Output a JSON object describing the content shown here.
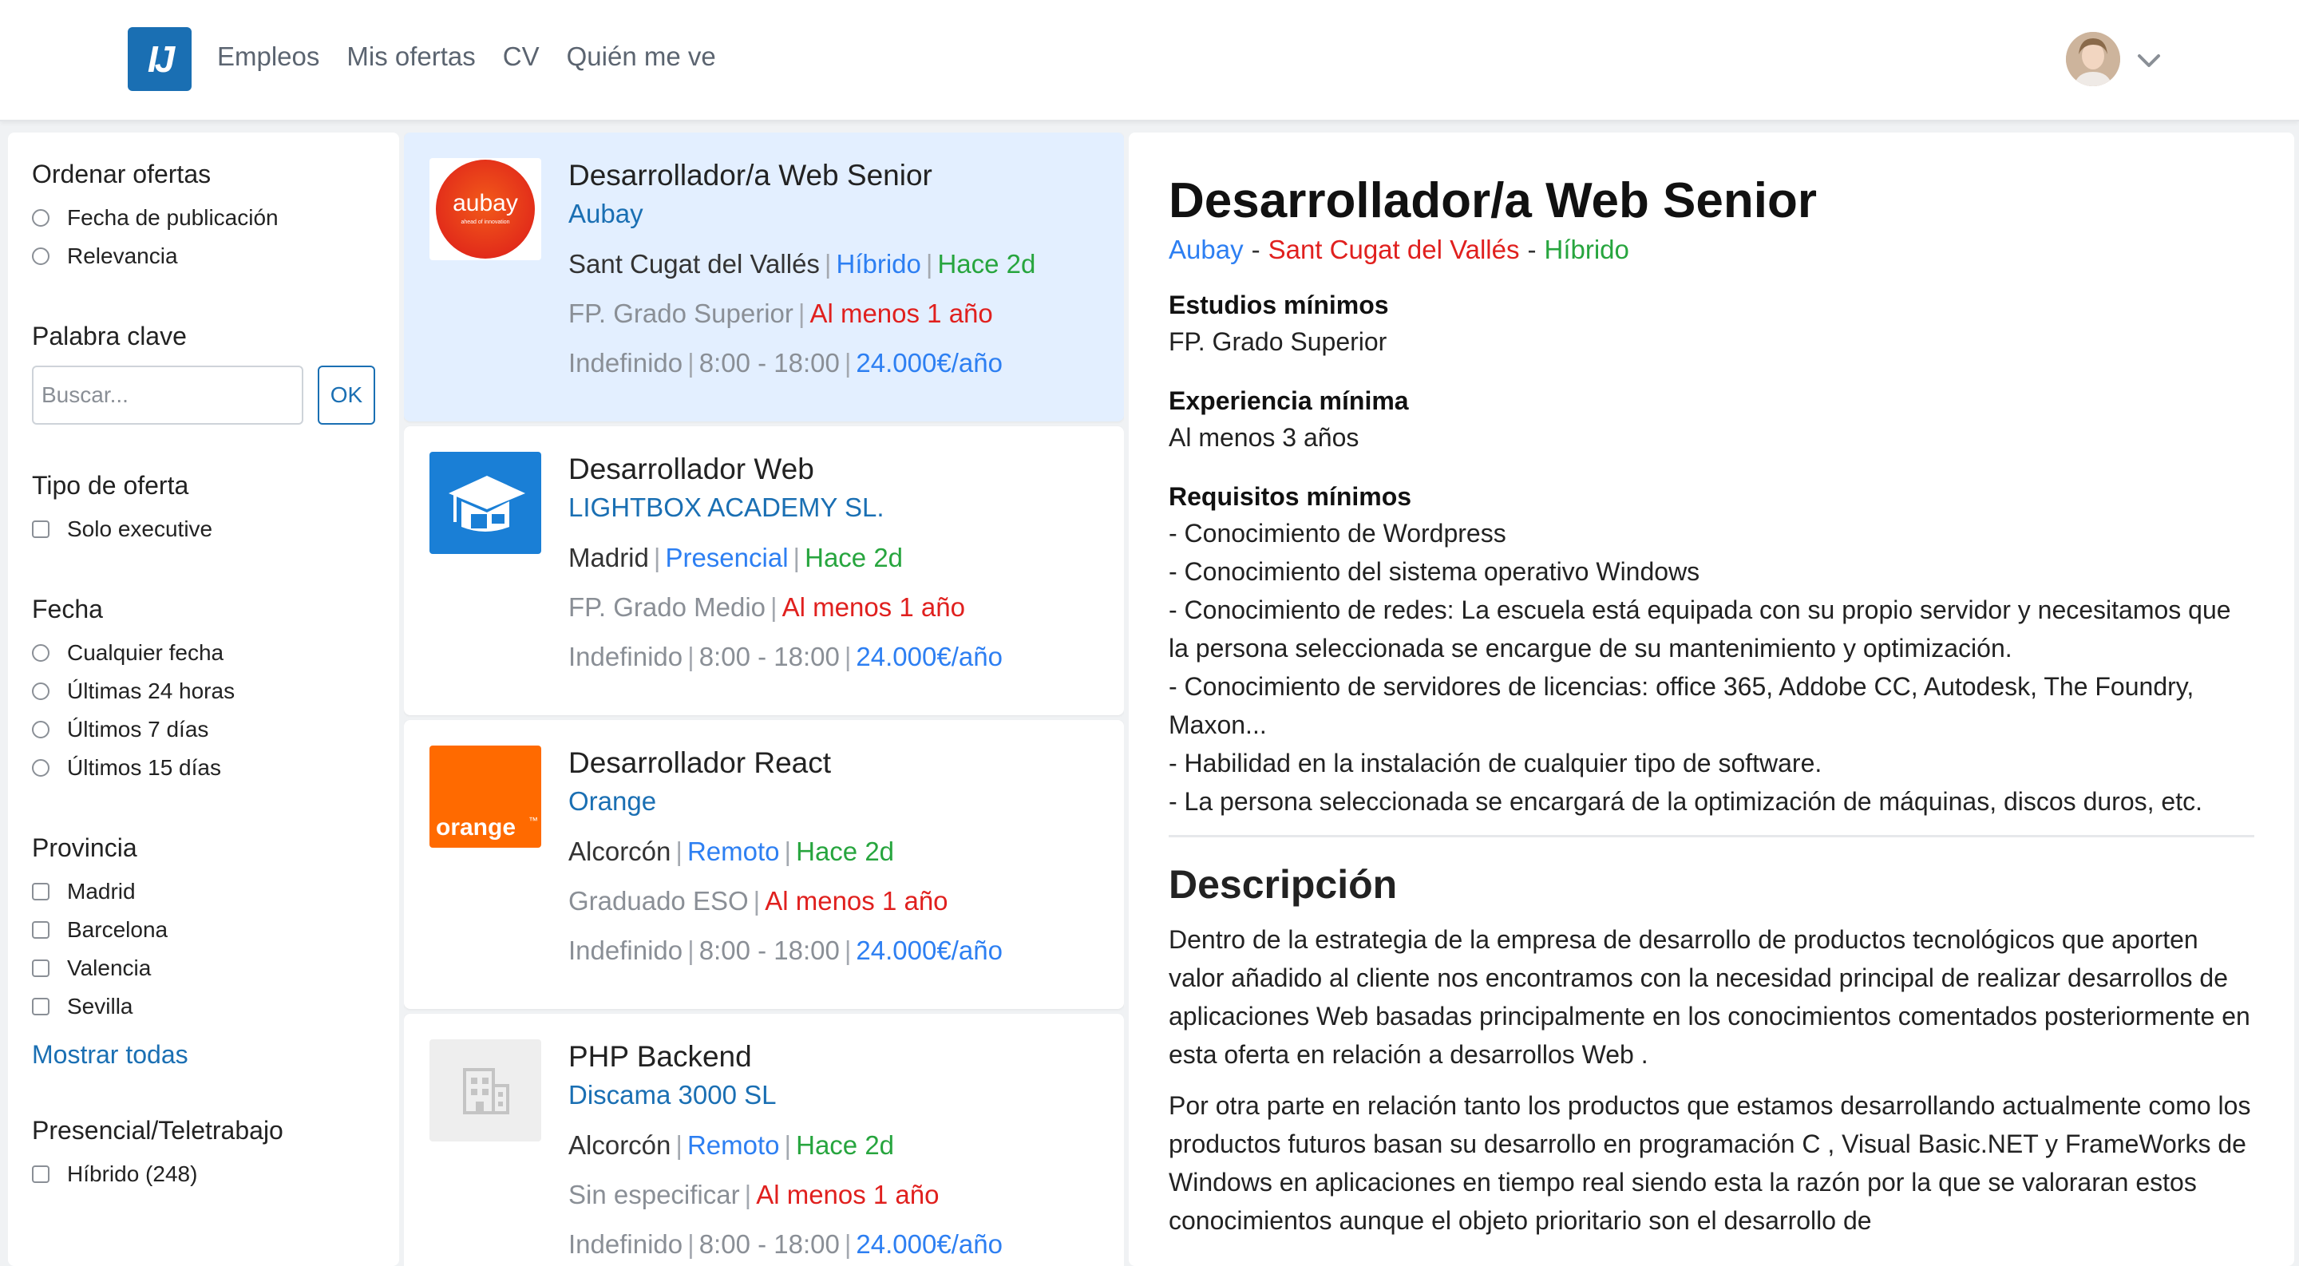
{
  "nav": {
    "logo": "IJ",
    "links": [
      "Empleos",
      "Mis ofertas",
      "CV",
      "Quién me ve"
    ]
  },
  "filters": {
    "order": {
      "title": "Ordenar ofertas",
      "options": [
        "Fecha de publicación",
        "Relevancia"
      ]
    },
    "keyword": {
      "title": "Palabra clave",
      "placeholder": "Buscar...",
      "button": "OK"
    },
    "type": {
      "title": "Tipo de oferta",
      "options": [
        "Solo executive"
      ]
    },
    "date": {
      "title": "Fecha",
      "options": [
        "Cualquier fecha",
        "Últimas 24 horas",
        "Últimos 7 días",
        "Últimos 15 días"
      ]
    },
    "province": {
      "title": "Provincia",
      "options": [
        "Madrid",
        "Barcelona",
        "Valencia",
        "Sevilla"
      ],
      "show_all": "Mostrar todas"
    },
    "mode": {
      "title": "Presencial/Teletrabajo",
      "options": [
        "Híbrido (248)"
      ]
    }
  },
  "jobs": [
    {
      "title": "Desarrollador/a Web Senior",
      "company": "Aubay",
      "city": "Sant Cugat del Vallés",
      "mode": "Híbrido",
      "age": "Hace 2d",
      "studies": "FP. Grado Superior",
      "experience": "Al menos 1 año",
      "contract": "Indefinido",
      "hours": "8:00 - 18:00",
      "salary": "24.000€/año",
      "logo_text": "aubay",
      "logo_sub": "ahead of innovation"
    },
    {
      "title": "Desarrollador Web",
      "company": "LIGHTBOX ACADEMY SL.",
      "city": "Madrid",
      "mode": "Presencial",
      "age": "Hace 2d",
      "studies": "FP. Grado Medio",
      "experience": "Al menos 1 año",
      "contract": "Indefinido",
      "hours": "8:00 - 18:00",
      "salary": "24.000€/año"
    },
    {
      "title": "Desarrollador React",
      "company": "Orange",
      "city": "Alcorcón",
      "mode": "Remoto",
      "age": "Hace 2d",
      "studies": "Graduado ESO",
      "experience": "Al menos 1 año",
      "contract": "Indefinido",
      "hours": "8:00 - 18:00",
      "salary": "24.000€/año",
      "logo_text": "orange",
      "logo_tm": "™"
    },
    {
      "title": "PHP Backend",
      "company": "Discama 3000 SL",
      "city": "Alcorcón",
      "mode": "Remoto",
      "age": "Hace 2d",
      "studies": "Sin especificar",
      "experience": "Al menos 1 año",
      "contract": "Indefinido",
      "hours": "8:00 - 18:00",
      "salary": "24.000€/año"
    }
  ],
  "detail": {
    "title": "Desarrollador/a Web Senior",
    "company": "Aubay",
    "city": "Sant Cugat del Vallés",
    "mode": "Híbrido",
    "dash": "-",
    "studies_label": "Estudios mínimos",
    "studies": "FP. Grado Superior",
    "experience_label": "Experiencia mínima",
    "experience": "Al menos 3 años",
    "requirements_label": "Requisitos mínimos",
    "requirements": [
      "- Conocimiento de Wordpress",
      "- Conocimiento del sistema operativo Windows",
      "- Conocimiento de redes: La escuela está equipada con su propio servidor y necesitamos que la persona seleccionada se encargue de su mantenimiento y optimización.",
      "- Conocimiento de servidores de licencias: office 365, Addobe CC, Autodesk, The Foundry, Maxon...",
      "- Habilidad en la instalación de cualquier tipo de software.",
      "- La persona seleccionada se encargará de la optimización de máquinas, discos duros, etc."
    ],
    "description_title": "Descripción",
    "description": [
      "Dentro de la estrategia de la empresa de desarrollo de productos tecnológicos que aporten valor añadido al cliente nos encontramos con la necesidad principal de realizar desarrollos de aplicaciones Web basadas principalmente en los conocimientos comentados posteriormente en esta oferta en relación a desarrollos Web .",
      "Por otra parte en relación tanto los productos que estamos desarrollando actualmente como los productos futuros basan su desarrollo en programación C , Visual Basic.NET y FrameWorks de Windows en aplicaciones en tiempo real siendo esta la razón por la que se valoraran estos conocimientos aunque el objeto prioritario son el desarrollo de"
    ]
  },
  "colors": {
    "accent": "#1a6fb3",
    "link": "#2d7ff2",
    "green": "#27a53e",
    "red": "#e0201e",
    "active_card": "#e3efff"
  },
  "icons": {
    "avatar": "user-avatar",
    "menu": "chevron-down-icon",
    "placeholder_logo": "building-icon",
    "lightbox_logo": "graduation-cap-icon"
  }
}
